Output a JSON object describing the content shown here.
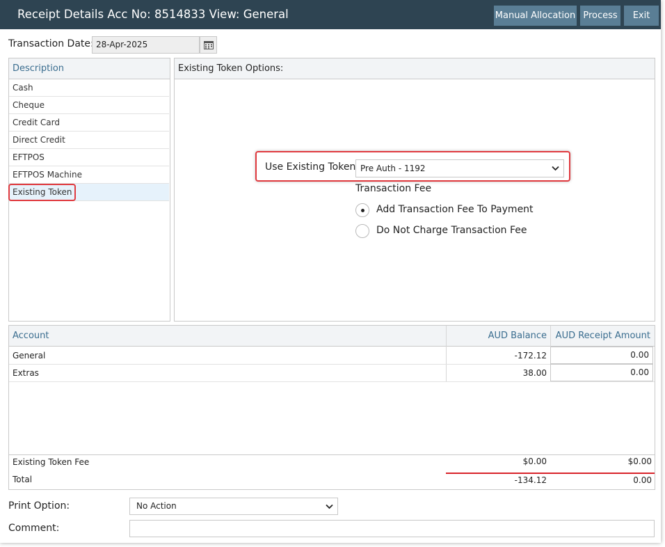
{
  "window": {
    "title": "Receipt Details Acc No: 8514833 View: General",
    "buttons": {
      "manual_allocation": "Manual Allocation",
      "process": "Process",
      "exit": "Exit"
    }
  },
  "transaction_date": {
    "label": "Transaction Date:",
    "value": "28-Apr-2025",
    "icon": "calendar-icon"
  },
  "description_panel": {
    "header": "Description",
    "items": [
      "Cash",
      "Cheque",
      "Credit Card",
      "Direct Credit",
      "EFTPOS",
      "EFTPOS Machine",
      "Existing Token"
    ],
    "selected": "Existing Token"
  },
  "token_options": {
    "header": "Existing Token Options:",
    "use_existing_token_label": "Use Existing Token:",
    "use_existing_token_value": "Pre Auth - 1192",
    "transaction_fee_label": "Transaction Fee",
    "radio_options": [
      {
        "label": "Add Transaction Fee To Payment",
        "checked": true
      },
      {
        "label": "Do Not Charge Transaction Fee",
        "checked": false
      }
    ]
  },
  "accounts_table": {
    "headers": {
      "account": "Account",
      "balance": "AUD Balance",
      "receipt": "AUD Receipt Amount"
    },
    "rows": [
      {
        "account": "General",
        "balance": "-172.12",
        "receipt": "0.00"
      },
      {
        "account": "Extras",
        "balance": "38.00",
        "receipt": "0.00"
      }
    ],
    "fee_row": {
      "label": "Existing Token Fee",
      "balance": "$0.00",
      "receipt": "$0.00"
    },
    "total_row": {
      "label": "Total",
      "balance": "-134.12",
      "receipt": "0.00"
    }
  },
  "print_option": {
    "label": "Print Option:",
    "value": "No Action"
  },
  "comment": {
    "label": "Comment:",
    "value": ""
  },
  "colors": {
    "titlebar": "#2e4452",
    "button": "#5a7e95",
    "highlight": "#e0393e",
    "header_text": "#3a6d8f",
    "selected_row": "#e6f2fb"
  }
}
